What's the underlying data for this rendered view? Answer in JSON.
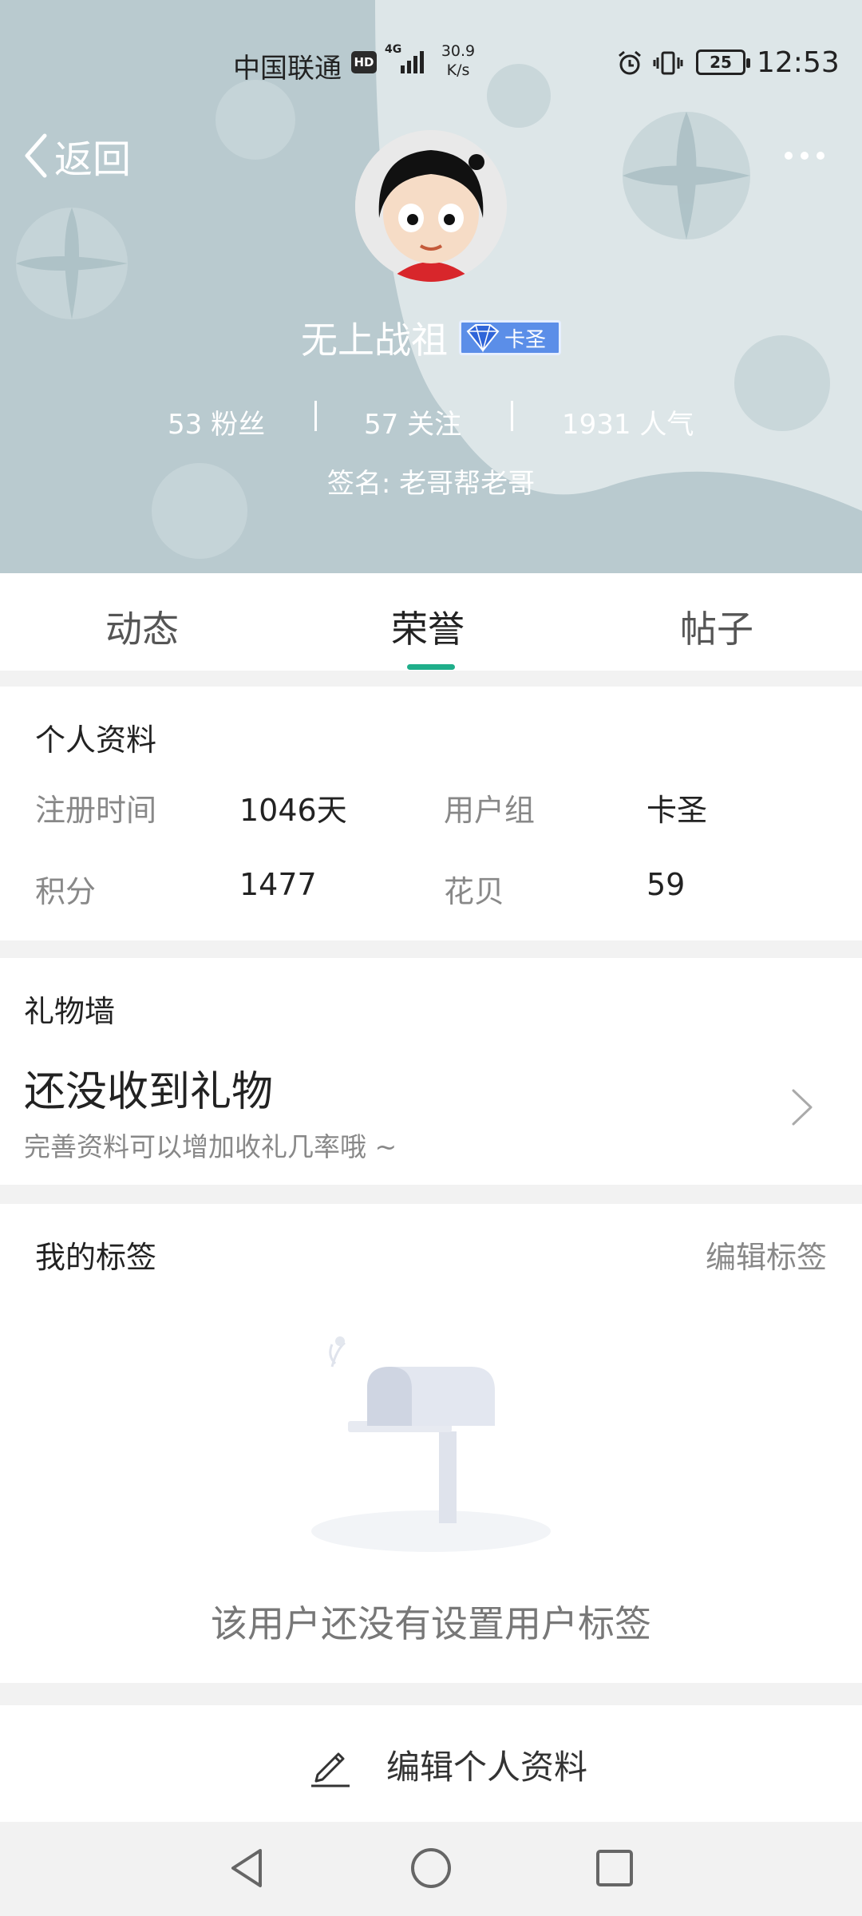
{
  "status_bar": {
    "carrier": "中国联通",
    "hd": "HD",
    "network": "4G",
    "speed_value": "30.9",
    "speed_unit": "K/s",
    "battery": "25",
    "time": "12:53",
    "icons": [
      "signal-icon",
      "alarm-icon",
      "vibrate-icon",
      "battery-icon"
    ]
  },
  "header": {
    "back_label": "返回",
    "nickname": "无上战祖",
    "badge_label": "卡圣",
    "stats": {
      "fans": "53 粉丝",
      "following": "57 关注",
      "popularity": "1931 人气"
    },
    "signature": "签名: 老哥帮老哥"
  },
  "tabs": [
    {
      "label": "动态",
      "active": false
    },
    {
      "label": "荣誉",
      "active": true
    },
    {
      "label": "帖子",
      "active": false
    }
  ],
  "profile": {
    "title": "个人资料",
    "fields": [
      {
        "label": "注册时间",
        "value": "1046天"
      },
      {
        "label": "用户组",
        "value": "卡圣"
      },
      {
        "label": "积分",
        "value": "1477"
      },
      {
        "label": "花贝",
        "value": "59"
      }
    ]
  },
  "gift_wall": {
    "title": "礼物墙",
    "empty_text": "还没收到礼物",
    "hint": "完善资料可以增加收礼几率哦 ~"
  },
  "tags": {
    "title": "我的标签",
    "edit_label": "编辑标签",
    "empty_text": "该用户还没有设置用户标签"
  },
  "edit_profile": {
    "label": "编辑个人资料"
  },
  "colors": {
    "accent": "#1fae8a",
    "header_bg": "#b9cacf",
    "badge_bg": "#5b8ee8"
  }
}
